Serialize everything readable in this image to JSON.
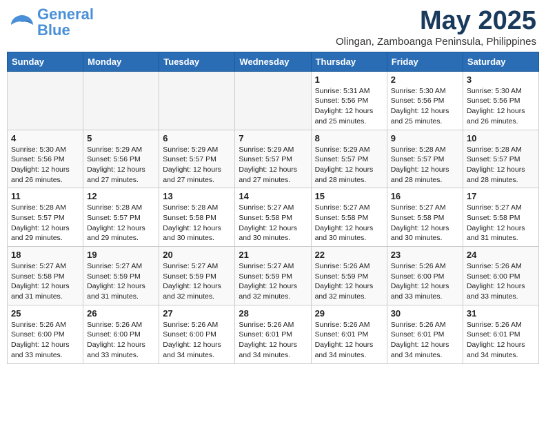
{
  "header": {
    "logo_general": "General",
    "logo_blue": "Blue",
    "month_title": "May 2025",
    "location": "Olingan, Zamboanga Peninsula, Philippines"
  },
  "weekdays": [
    "Sunday",
    "Monday",
    "Tuesday",
    "Wednesday",
    "Thursday",
    "Friday",
    "Saturday"
  ],
  "weeks": [
    [
      {
        "day": "",
        "empty": true
      },
      {
        "day": "",
        "empty": true
      },
      {
        "day": "",
        "empty": true
      },
      {
        "day": "",
        "empty": true
      },
      {
        "day": "1",
        "sunrise": "5:31 AM",
        "sunset": "5:56 PM",
        "daylight": "12 hours and 25 minutes."
      },
      {
        "day": "2",
        "sunrise": "5:30 AM",
        "sunset": "5:56 PM",
        "daylight": "12 hours and 25 minutes."
      },
      {
        "day": "3",
        "sunrise": "5:30 AM",
        "sunset": "5:56 PM",
        "daylight": "12 hours and 26 minutes."
      }
    ],
    [
      {
        "day": "4",
        "sunrise": "5:30 AM",
        "sunset": "5:56 PM",
        "daylight": "12 hours and 26 minutes."
      },
      {
        "day": "5",
        "sunrise": "5:29 AM",
        "sunset": "5:56 PM",
        "daylight": "12 hours and 27 minutes."
      },
      {
        "day": "6",
        "sunrise": "5:29 AM",
        "sunset": "5:57 PM",
        "daylight": "12 hours and 27 minutes."
      },
      {
        "day": "7",
        "sunrise": "5:29 AM",
        "sunset": "5:57 PM",
        "daylight": "12 hours and 27 minutes."
      },
      {
        "day": "8",
        "sunrise": "5:29 AM",
        "sunset": "5:57 PM",
        "daylight": "12 hours and 28 minutes."
      },
      {
        "day": "9",
        "sunrise": "5:28 AM",
        "sunset": "5:57 PM",
        "daylight": "12 hours and 28 minutes."
      },
      {
        "day": "10",
        "sunrise": "5:28 AM",
        "sunset": "5:57 PM",
        "daylight": "12 hours and 28 minutes."
      }
    ],
    [
      {
        "day": "11",
        "sunrise": "5:28 AM",
        "sunset": "5:57 PM",
        "daylight": "12 hours and 29 minutes."
      },
      {
        "day": "12",
        "sunrise": "5:28 AM",
        "sunset": "5:57 PM",
        "daylight": "12 hours and 29 minutes."
      },
      {
        "day": "13",
        "sunrise": "5:28 AM",
        "sunset": "5:58 PM",
        "daylight": "12 hours and 30 minutes."
      },
      {
        "day": "14",
        "sunrise": "5:27 AM",
        "sunset": "5:58 PM",
        "daylight": "12 hours and 30 minutes."
      },
      {
        "day": "15",
        "sunrise": "5:27 AM",
        "sunset": "5:58 PM",
        "daylight": "12 hours and 30 minutes."
      },
      {
        "day": "16",
        "sunrise": "5:27 AM",
        "sunset": "5:58 PM",
        "daylight": "12 hours and 30 minutes."
      },
      {
        "day": "17",
        "sunrise": "5:27 AM",
        "sunset": "5:58 PM",
        "daylight": "12 hours and 31 minutes."
      }
    ],
    [
      {
        "day": "18",
        "sunrise": "5:27 AM",
        "sunset": "5:58 PM",
        "daylight": "12 hours and 31 minutes."
      },
      {
        "day": "19",
        "sunrise": "5:27 AM",
        "sunset": "5:59 PM",
        "daylight": "12 hours and 31 minutes."
      },
      {
        "day": "20",
        "sunrise": "5:27 AM",
        "sunset": "5:59 PM",
        "daylight": "12 hours and 32 minutes."
      },
      {
        "day": "21",
        "sunrise": "5:27 AM",
        "sunset": "5:59 PM",
        "daylight": "12 hours and 32 minutes."
      },
      {
        "day": "22",
        "sunrise": "5:26 AM",
        "sunset": "5:59 PM",
        "daylight": "12 hours and 32 minutes."
      },
      {
        "day": "23",
        "sunrise": "5:26 AM",
        "sunset": "6:00 PM",
        "daylight": "12 hours and 33 minutes."
      },
      {
        "day": "24",
        "sunrise": "5:26 AM",
        "sunset": "6:00 PM",
        "daylight": "12 hours and 33 minutes."
      }
    ],
    [
      {
        "day": "25",
        "sunrise": "5:26 AM",
        "sunset": "6:00 PM",
        "daylight": "12 hours and 33 minutes."
      },
      {
        "day": "26",
        "sunrise": "5:26 AM",
        "sunset": "6:00 PM",
        "daylight": "12 hours and 33 minutes."
      },
      {
        "day": "27",
        "sunrise": "5:26 AM",
        "sunset": "6:00 PM",
        "daylight": "12 hours and 34 minutes."
      },
      {
        "day": "28",
        "sunrise": "5:26 AM",
        "sunset": "6:01 PM",
        "daylight": "12 hours and 34 minutes."
      },
      {
        "day": "29",
        "sunrise": "5:26 AM",
        "sunset": "6:01 PM",
        "daylight": "12 hours and 34 minutes."
      },
      {
        "day": "30",
        "sunrise": "5:26 AM",
        "sunset": "6:01 PM",
        "daylight": "12 hours and 34 minutes."
      },
      {
        "day": "31",
        "sunrise": "5:26 AM",
        "sunset": "6:01 PM",
        "daylight": "12 hours and 34 minutes."
      }
    ]
  ]
}
